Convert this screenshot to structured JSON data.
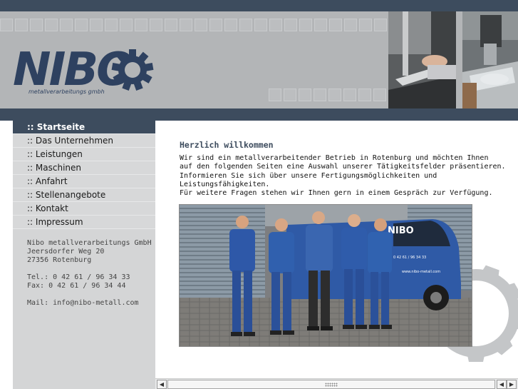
{
  "brand": {
    "logo_text": "NIBO",
    "tagline": "metallverarbeitungs gmbh"
  },
  "nav": {
    "items": [
      {
        "label": ":: Startseite",
        "active": true
      },
      {
        "label": ":: Das Unternehmen",
        "active": false
      },
      {
        "label": ":: Leistungen",
        "active": false
      },
      {
        "label": ":: Maschinen",
        "active": false
      },
      {
        "label": ":: Anfahrt",
        "active": false
      },
      {
        "label": ":: Stellenangebote",
        "active": false
      },
      {
        "label": ":: Kontakt",
        "active": false
      },
      {
        "label": ":: Impressum",
        "active": false
      }
    ]
  },
  "address": {
    "company": "Nibo metallverarbeitungs GmbH",
    "street": "Jeersdorfer Weg 20",
    "city": "27356 Rotenburg",
    "tel": "Tel.: 0 42 61 / 96 34 33",
    "fax": "Fax: 0 42 61 / 96 34 44",
    "mail": "Mail: info@nibo-metall.com"
  },
  "main": {
    "title": "Herzlich willkommen",
    "intro_lines": [
      "Wir sind ein metallverarbeitender Betrieb in Rotenburg und möchten Ihnen",
      "auf den folgenden Seiten eine Auswahl unserer Tätigkeitsfelder präsentieren.",
      "Informieren Sie sich über unsere Fertigungsmöglichkeiten und",
      "Leistungsfähigkeiten.",
      "Für weitere Fragen stehen wir Ihnen gern in einem Gespräch zur Verfügung."
    ],
    "van_logo": "NIBO",
    "van_phone": "0 42 61 / 96 34 33",
    "van_web": "www.nibo-metall.com"
  },
  "colors": {
    "header_bar": "#3d4c5e",
    "header_bg": "#b3b5b7",
    "sidebar_bg": "#d4d5d6",
    "brand_blue": "#2e4160"
  },
  "icons": {
    "logo_gear": "gear-icon",
    "scroll_left": "arrow-left-icon",
    "scroll_right": "arrow-right-icon"
  }
}
